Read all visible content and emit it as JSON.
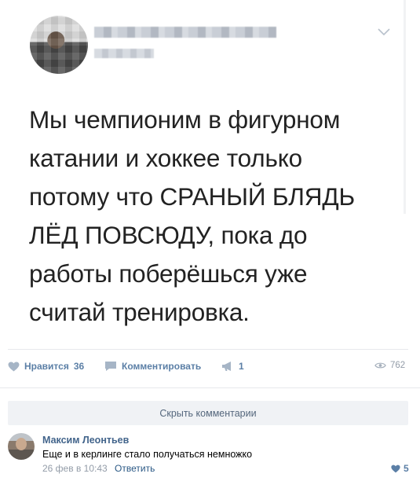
{
  "post": {
    "text_lines": [
      "Мы чемпионим в фигурном",
      "катании и хоккее только",
      "потому что СРАНЫЙ БЛЯДЬ",
      "ЛЁД ПОВСЮДУ, пока до",
      "работы поберёшься уже",
      "считай тренировка."
    ]
  },
  "actions": {
    "like_label": "Нравится",
    "like_count": "36",
    "comment_label": "Комментировать",
    "share_count": "1",
    "views_count": "762"
  },
  "comments": {
    "hide_label": "Скрыть комментарии",
    "items": [
      {
        "author": "Максим Леонтьев",
        "text": "Еще и в керлинге стало получаться немножко",
        "date": "26 фев в 10:43",
        "reply_label": "Ответить",
        "likes": "5"
      }
    ]
  },
  "colors": {
    "link": "#2a5885",
    "action": "#5b7fa6",
    "muted": "#939ca8"
  },
  "icons": {
    "menu": "chevron-down-icon",
    "like": "heart-icon",
    "comment": "comment-icon",
    "share": "megaphone-icon",
    "views": "eye-icon"
  }
}
